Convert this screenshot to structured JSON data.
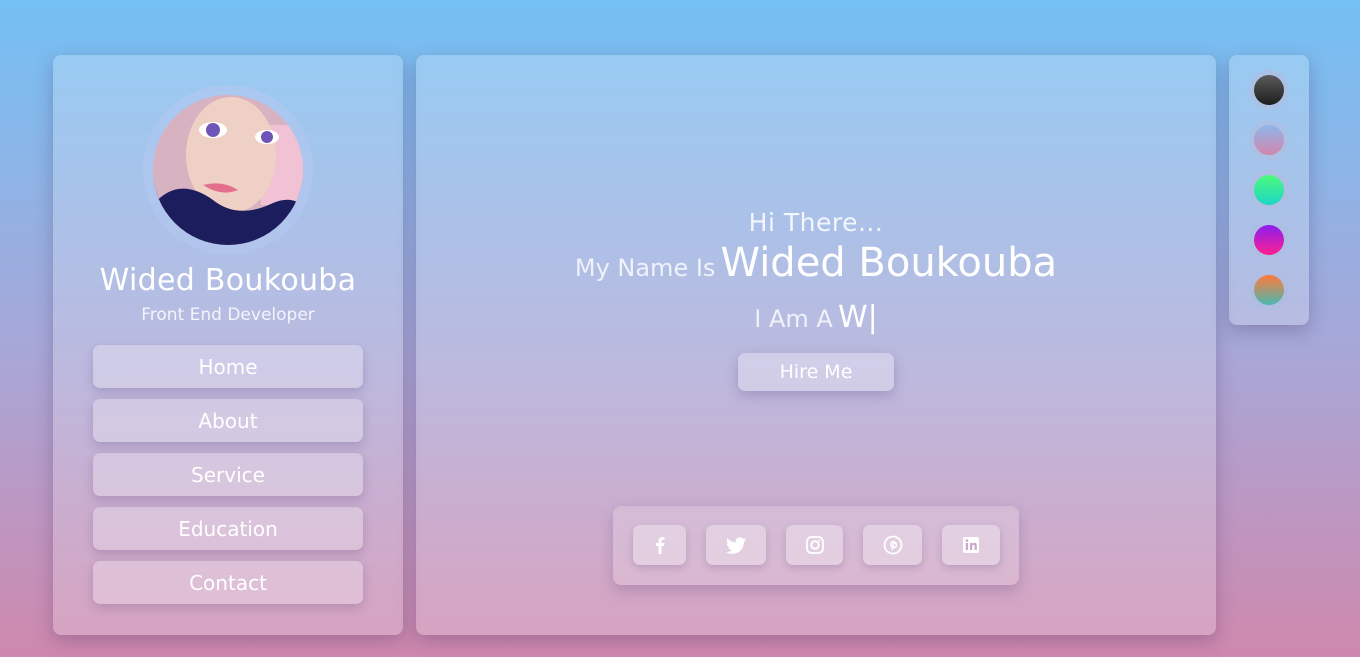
{
  "profile": {
    "name": "Wided Boukouba",
    "role": "Front End Developer"
  },
  "nav": {
    "items": [
      {
        "label": "Home"
      },
      {
        "label": "About"
      },
      {
        "label": "Service"
      },
      {
        "label": "Education"
      },
      {
        "label": "Contact"
      }
    ]
  },
  "hero": {
    "greeting": "Hi There...",
    "name_prefix": "My Name Is",
    "name": "Wided Boukouba",
    "iam_prefix": "I Am A",
    "typed_text": "W|",
    "hire_label": "Hire Me"
  },
  "social": {
    "icons": [
      "facebook-icon",
      "twitter-icon",
      "instagram-icon",
      "pinterest-icon",
      "linkedin-icon"
    ]
  },
  "theme_swatches": [
    {
      "name": "dark",
      "from": "#5a5a5a",
      "to": "#1e1e1e"
    },
    {
      "name": "blue-pink",
      "from": "#8fb6ea",
      "to": "#d286ad"
    },
    {
      "name": "green-teal",
      "from": "#4dfa7c",
      "to": "#1ed6c4"
    },
    {
      "name": "purple-pink",
      "from": "#8a1ff0",
      "to": "#ff1f8f"
    },
    {
      "name": "orange-teal",
      "from": "#ff7a3a",
      "to": "#4ab8b0"
    }
  ]
}
